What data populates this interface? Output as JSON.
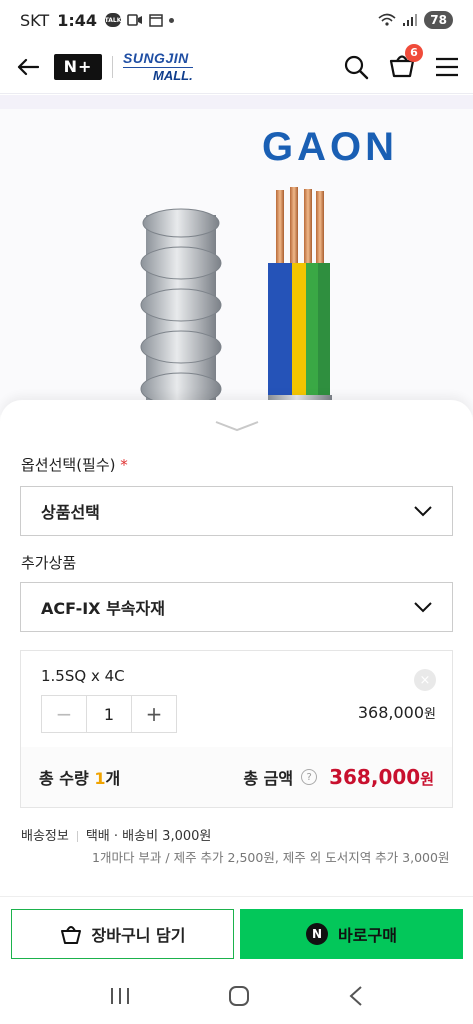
{
  "status_bar": {
    "carrier": "SKT",
    "time": "1:44",
    "talk_badge": "TALK",
    "battery": "78"
  },
  "header": {
    "logo_nplus": "N+",
    "brand_top": "SUNGJIN",
    "brand_bottom": "MALL.",
    "cart_count": "6"
  },
  "product": {
    "brand_logo_text": "GAON"
  },
  "options": {
    "required_label": "옵션선택(필수)",
    "required_mark": "*",
    "select_placeholder": "상품선택",
    "extra_label": "추가상품",
    "extra_selected": "ACF-IX 부속자재"
  },
  "selected_item": {
    "name": "1.5SQ x 4C",
    "quantity": "1",
    "minus": "−",
    "plus": "+",
    "price": "368,000",
    "price_unit": "원",
    "close": "×"
  },
  "totals": {
    "qty_label": "총 수량",
    "qty_value": "1",
    "qty_unit": "개",
    "amount_label": "총 금액",
    "help": "?",
    "amount_value": "368,000",
    "amount_unit": "원"
  },
  "shipping": {
    "label": "배송정보",
    "method": "택배 · 배송비 3,000원",
    "note": "1개마다 부과 / 제주 추가 2,500원, 제주 외 도서지역 추가 3,000원"
  },
  "buttons": {
    "cart": "장바구니 담기",
    "buy_icon": "N",
    "buy": "바로구매"
  },
  "colors": {
    "accent_green": "#03c75a",
    "price_red": "#c8102e",
    "qty_orange": "#f0a300",
    "brand_blue": "#1a5fb4"
  }
}
